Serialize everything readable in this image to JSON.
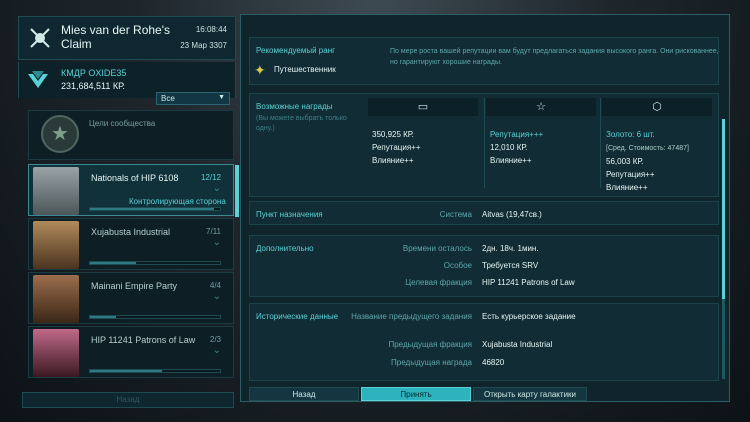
{
  "station": {
    "name": "Mies van der Rohe's Claim",
    "time": "16:08:44",
    "date": "23 Мар 3307"
  },
  "commander": {
    "name": "КМДР OXIDE35",
    "credits": "231,684,511 КР."
  },
  "filter": {
    "value": "Все",
    "arrow": "▼"
  },
  "community": {
    "label": "Цели сообщества"
  },
  "factions": [
    {
      "name": "Nationals of HIP 6108",
      "count": "12/12",
      "controlling": "Контролирующая сторона",
      "reputation": 0.95,
      "active": true
    },
    {
      "name": "Xujabusta Industrial",
      "count": "7/11",
      "reputation": 0.35,
      "active": false
    },
    {
      "name": "Mainani Empire Party",
      "count": "4/4",
      "reputation": 0.2,
      "active": false
    },
    {
      "name": "HIP 11241 Patrons of Law",
      "count": "2/3",
      "reputation": 0.55,
      "active": false
    }
  ],
  "bottom_left_label": "Назад",
  "rank": {
    "title": "Рекомендуемый ранг",
    "name": "Путешественник",
    "description": "По мере роста вашей репутации вам будут предлагаться задания высокого ранга. Они рискованнее, но гарантируют хорошие награды."
  },
  "rewards": {
    "title": "Возможные награды",
    "subtitle": "(Вы можете выбрать только одну.)",
    "columns": [
      {
        "icon": "▭",
        "items": [
          "350,925 КР.",
          "Репутация++",
          "Влияние++"
        ],
        "emph": [
          false,
          false,
          false
        ]
      },
      {
        "icon": "☆",
        "items": [
          "Репутация+++",
          "12,010 КР.",
          "Влияние++"
        ],
        "emph": [
          true,
          false,
          false
        ]
      },
      {
        "icon": "⬡",
        "items": [
          "Золото: 6 шт.",
          "[Сред. Стоимость: 47487]",
          "56,003 КР.",
          "Репутация++",
          "Влияние++"
        ],
        "emph": [
          true,
          false,
          false,
          false,
          false
        ]
      }
    ]
  },
  "destination": {
    "title": "Пункт назначения",
    "key": "Система",
    "value": "Aitvas (19,47св.)"
  },
  "additional": {
    "title": "Дополнительно",
    "rows": [
      {
        "k": "Времени осталось",
        "v": "2дн. 18ч. 1мин."
      },
      {
        "k": "Особое",
        "v": "Требуется SRV"
      },
      {
        "k": "Целевая фракция",
        "v": "HIP 11241 Patrons of Law"
      }
    ]
  },
  "history": {
    "title": "Исторические данные",
    "rows": [
      {
        "k": "Название предыдущего задания",
        "v": "Есть курьерское задание"
      },
      {
        "k": "Предыдущая фракция",
        "v": "Xujabusta Industrial"
      },
      {
        "k": "Предыдущая награда",
        "v": "46820"
      }
    ]
  },
  "buttons": {
    "back": "Назад",
    "accept": "Принять",
    "galaxy": "Открыть карту галактики"
  }
}
